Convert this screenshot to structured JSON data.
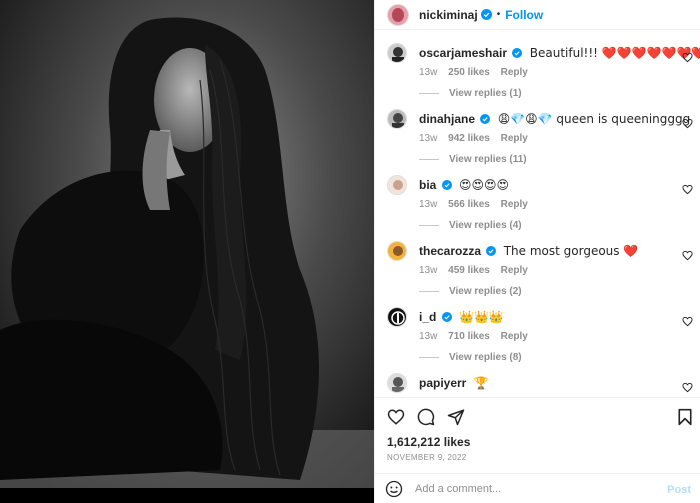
{
  "header": {
    "username": "nickiminaj",
    "separator": "•",
    "follow_label": "Follow"
  },
  "comments": [
    {
      "username": "oscarjameshair",
      "text": "Beautiful!!! ❤️❤️❤️❤️❤️❤️❤️",
      "time": "13w",
      "likes": "250 likes",
      "reply": "Reply",
      "replies": "View replies (1)",
      "verified": true
    },
    {
      "username": "dinahjane",
      "text": "😩💎😩💎 queen is queeningggg",
      "time": "13w",
      "likes": "942 likes",
      "reply": "Reply",
      "replies": "View replies (11)",
      "verified": true
    },
    {
      "username": "bia",
      "text": "😍😍😍😍",
      "time": "13w",
      "likes": "566 likes",
      "reply": "Reply",
      "replies": "View replies (4)",
      "verified": true
    },
    {
      "username": "thecarozza",
      "text": "The most gorgeous ❤️",
      "time": "13w",
      "likes": "459 likes",
      "reply": "Reply",
      "replies": "View replies (2)",
      "verified": true
    },
    {
      "username": "i_d",
      "text": "👑👑👑",
      "time": "13w",
      "likes": "710 likes",
      "reply": "Reply",
      "replies": "View replies (8)",
      "verified": true
    },
    {
      "username": "papiyerr",
      "text": "🏆",
      "time": "",
      "likes": "",
      "reply": "",
      "replies": "",
      "verified": false
    }
  ],
  "likes_count": "1,612,212 likes",
  "date": "NOVEMBER 9, 2022",
  "add_comment": {
    "placeholder": "Add a comment...",
    "post_label": "Post"
  },
  "colors": {
    "accent": "#0095f6",
    "muted": "#8e8e8e",
    "text": "#262626"
  },
  "icons": [
    "heart-icon",
    "comment-icon",
    "share-icon",
    "bookmark-icon",
    "emoji-icon",
    "verified-badge-icon"
  ]
}
